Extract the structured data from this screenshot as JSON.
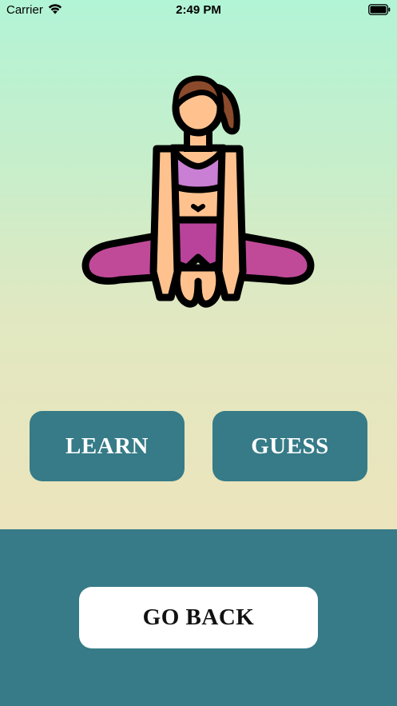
{
  "status_bar": {
    "carrier": "Carrier",
    "time": "2:49 PM",
    "wifi_icon": "wifi-icon",
    "battery_icon": "battery-icon"
  },
  "illustration": {
    "icon": "yoga-pose-icon"
  },
  "buttons": {
    "learn_label": "LEARN",
    "guess_label": "GUESS",
    "go_back_label": "GO BACK"
  },
  "colors": {
    "accent_teal": "#367b87",
    "gradient_top": "#b2f4d6",
    "gradient_bottom": "#ece4bc",
    "button_text": "#ffffff",
    "go_back_bg": "#ffffff"
  }
}
